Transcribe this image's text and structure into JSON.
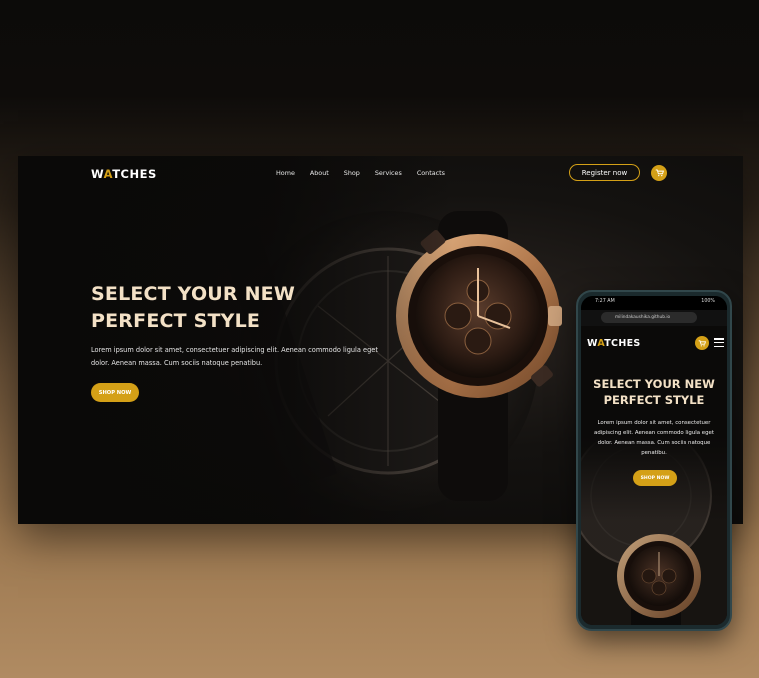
{
  "colors": {
    "accent": "#d4a017",
    "title": "#f3e1c6",
    "background_top": "#0c0b09",
    "background_bottom": "#b08b62"
  },
  "brand": {
    "logo_w": "W",
    "logo_a": "A",
    "logo_rest": "TCHES"
  },
  "nav": {
    "items": [
      "Home",
      "About",
      "Shop",
      "Services",
      "Contacts"
    ]
  },
  "header": {
    "register_label": "Register now",
    "cart_icon": "cart-icon"
  },
  "hero": {
    "title_line1": "SELECT YOUR NEW",
    "title_line2": "PERFECT STYLE",
    "description": "Lorem ipsum dolor sit amet, consectetuer adipiscing elit. Aenean commodo ligula eget dolor. Aenean massa. Cum sociis natoque penatibu.",
    "cta_label": "SHOP NOW"
  },
  "phone": {
    "status_time": "7:27 AM",
    "status_battery": "100%",
    "url": "milindakaushika.github.io",
    "menu_icon": "hamburger-menu-icon"
  }
}
